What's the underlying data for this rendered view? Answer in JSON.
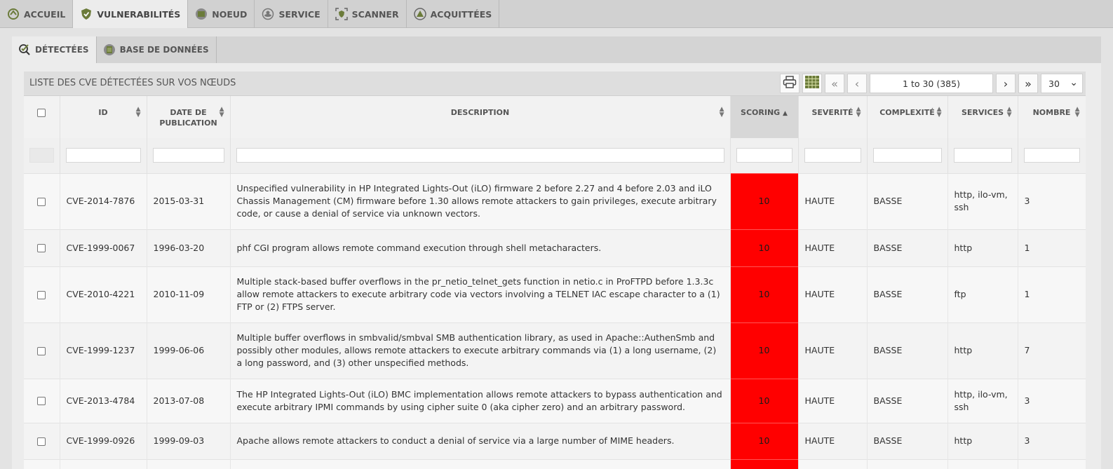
{
  "top_nav": [
    {
      "label": "ACCUEIL",
      "icon": "home-icon"
    },
    {
      "label": "VULNERABILITÉS",
      "icon": "shield-icon"
    },
    {
      "label": "NOEUD",
      "icon": "node-icon"
    },
    {
      "label": "SERVICE",
      "icon": "service-icon"
    },
    {
      "label": "SCANNER",
      "icon": "scanner-icon"
    },
    {
      "label": "ACQUITTÉES",
      "icon": "acknowledged-icon"
    }
  ],
  "sub_nav": [
    {
      "label": "DÉTECTÉES",
      "icon": "detected-check-icon"
    },
    {
      "label": "BASE DE DONNÉES",
      "icon": "database-icon"
    }
  ],
  "table_title": "LISTE DES CVE DÉTECTÉES SUR VOS NŒUDS",
  "pager": {
    "info": "1 to 30 (385)",
    "page_size": "30"
  },
  "columns": {
    "id": "ID",
    "date": "DATE DE PUBLICATION",
    "description": "DESCRIPTION",
    "scoring": "SCORING",
    "severity": "SEVERITÉ",
    "complexity": "COMPLEXITÉ",
    "services": "SERVICES",
    "count": "NOMBRE"
  },
  "rows": [
    {
      "id": "CVE-2014-7876",
      "date": "2015-03-31",
      "description": "Unspecified vulnerability in HP Integrated Lights-Out (iLO) firmware 2 before 2.27 and 4 before 2.03 and iLO Chassis Management (CM) firmware before 1.30 allows remote attackers to gain privileges, execute arbitrary code, or cause a denial of service via unknown vectors.",
      "score": "10",
      "severity": "HAUTE",
      "complexity": "BASSE",
      "services": "http, ilo-vm, ssh",
      "count": "3"
    },
    {
      "id": "CVE-1999-0067",
      "date": "1996-03-20",
      "description": "phf CGI program allows remote command execution through shell metacharacters.",
      "score": "10",
      "severity": "HAUTE",
      "complexity": "BASSE",
      "services": "http",
      "count": "1"
    },
    {
      "id": "CVE-2010-4221",
      "date": "2010-11-09",
      "description": "Multiple stack-based buffer overflows in the pr_netio_telnet_gets function in netio.c in ProFTPD before 1.3.3c allow remote attackers to execute arbitrary code via vectors involving a TELNET IAC escape character to a (1) FTP or (2) FTPS server.",
      "score": "10",
      "severity": "HAUTE",
      "complexity": "BASSE",
      "services": "ftp",
      "count": "1"
    },
    {
      "id": "CVE-1999-1237",
      "date": "1999-06-06",
      "description": "Multiple buffer overflows in smbvalid/smbval SMB authentication library, as used in Apache::AuthenSmb and possibly other modules, allows remote attackers to execute arbitrary commands via (1) a long username, (2) a long password, and (3) other unspecified methods.",
      "score": "10",
      "severity": "HAUTE",
      "complexity": "BASSE",
      "services": "http",
      "count": "7"
    },
    {
      "id": "CVE-2013-4784",
      "date": "2013-07-08",
      "description": "The HP Integrated Lights-Out (iLO) BMC implementation allows remote attackers to bypass authentication and execute arbitrary IPMI commands by using cipher suite 0 (aka cipher zero) and an arbitrary password.",
      "score": "10",
      "severity": "HAUTE",
      "complexity": "BASSE",
      "services": "http, ilo-vm, ssh",
      "count": "3"
    },
    {
      "id": "CVE-1999-0926",
      "date": "1999-09-03",
      "description": "Apache allows remote attackers to conduct a denial of service via a large number of MIME headers.",
      "score": "10",
      "severity": "HAUTE",
      "complexity": "BASSE",
      "services": "http",
      "count": "3"
    },
    {
      "id": "",
      "date": "",
      "description": "",
      "score": "",
      "severity": "",
      "complexity": "",
      "services": "",
      "count": ""
    }
  ],
  "colors": {
    "score_high": "#ff0000"
  }
}
